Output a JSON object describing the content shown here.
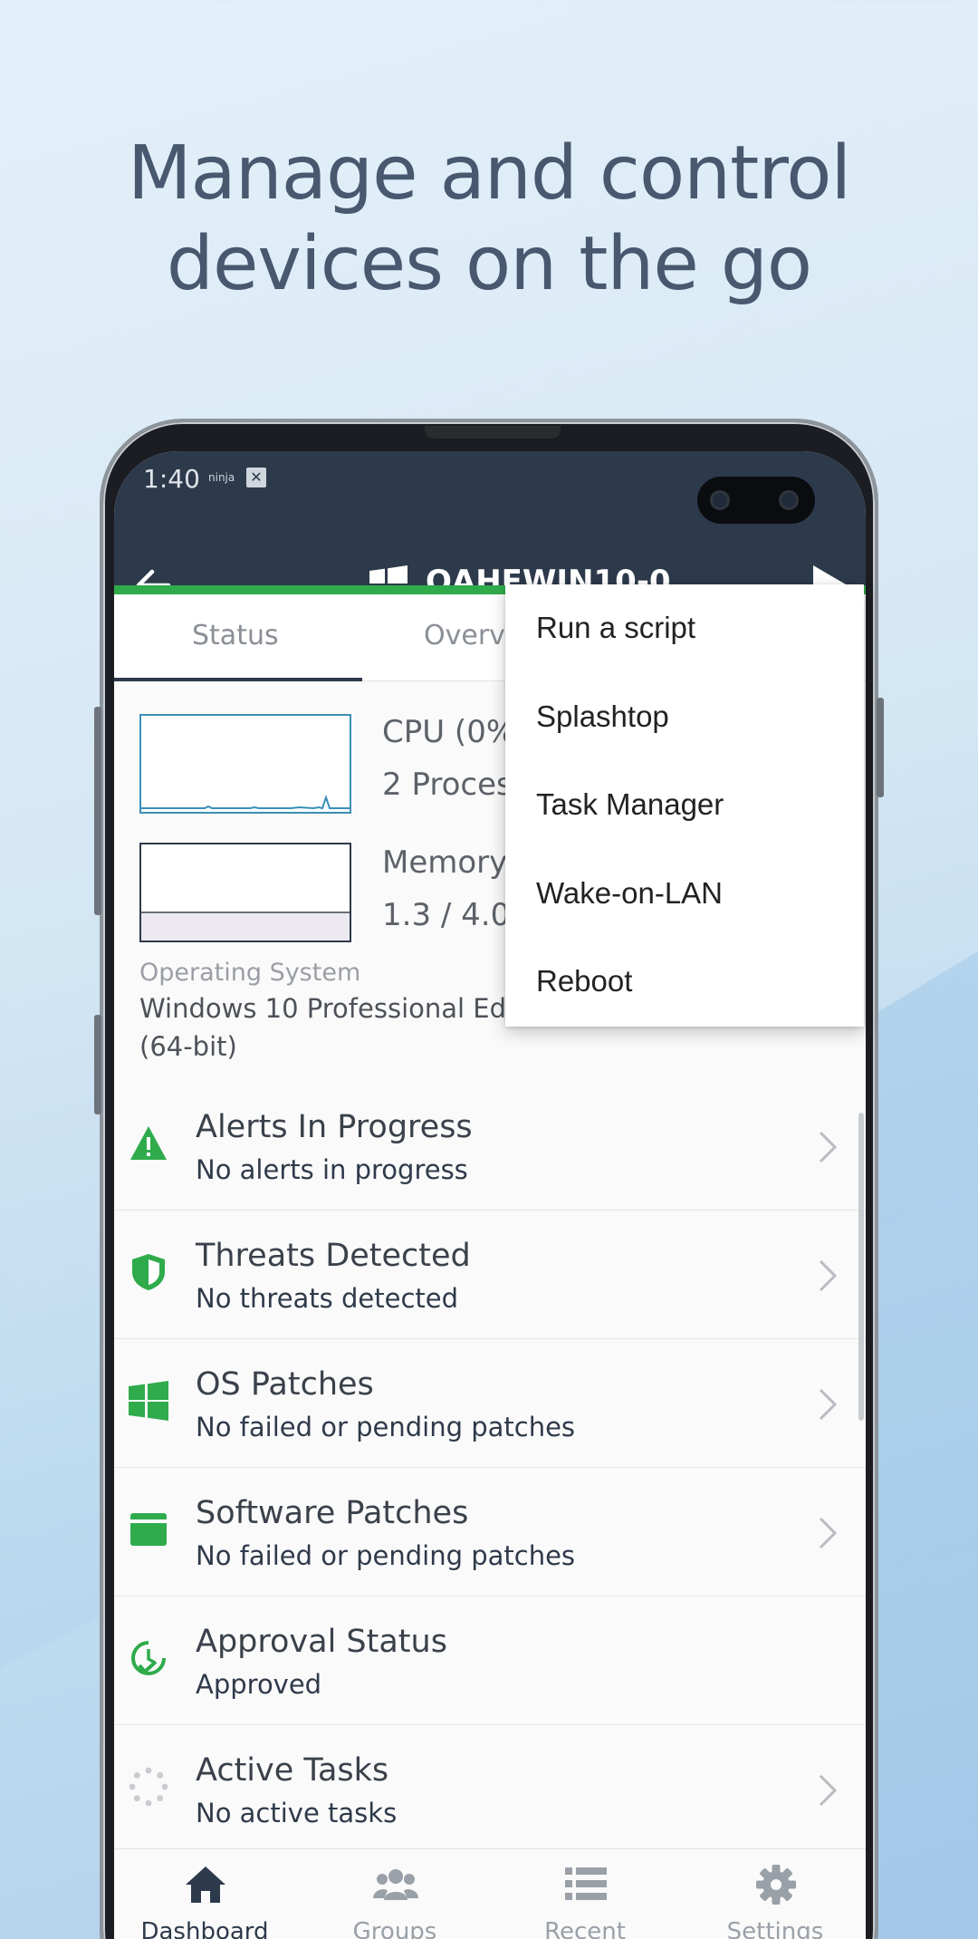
{
  "headline": {
    "line1": "Manage and control",
    "line2": "devices on the go"
  },
  "statusbar": {
    "time": "1:40",
    "app_tag": "ninja",
    "close_glyph": "✕"
  },
  "appbar": {
    "title": "QAHFWIN10-0",
    "back_icon": "arrow-left-icon",
    "os_icon": "windows-icon",
    "action_icon": "play-icon"
  },
  "tabs": [
    {
      "label": "Status",
      "active": true
    },
    {
      "label": "Overv"
    }
  ],
  "metrics": {
    "cpu_title": "CPU (0%",
    "cpu_sub": "2 Proces",
    "memory_title": "Memory",
    "memory_sub": "1.3 / 4.0"
  },
  "os": {
    "label": "Operating System",
    "value_line1": "Windows 10 Professional Ed",
    "value_line2": "(64-bit)"
  },
  "list": [
    {
      "title": "Alerts In Progress",
      "subtitle": "No alerts in progress",
      "icon": "warning-icon",
      "color": "#2fab4c",
      "chevron": true
    },
    {
      "title": "Threats Detected",
      "subtitle": "No threats detected",
      "icon": "shield-icon",
      "color": "#2fab4c",
      "chevron": true
    },
    {
      "title": "OS Patches",
      "subtitle": "No failed or pending patches",
      "icon": "windows-icon",
      "color": "#2fab4c",
      "chevron": true
    },
    {
      "title": "Software Patches",
      "subtitle": "No failed or pending patches",
      "icon": "software-icon",
      "color": "#2fab4c",
      "chevron": true
    },
    {
      "title": "Approval Status",
      "subtitle": "Approved",
      "icon": "clock-check-icon",
      "color": "#2fab4c",
      "chevron": false
    },
    {
      "title": "Active Tasks",
      "subtitle": "No active tasks",
      "icon": "spinner-icon",
      "color": "#c8cbd0",
      "chevron": true
    }
  ],
  "menu": [
    {
      "label": "Run a script"
    },
    {
      "label": "Splashtop"
    },
    {
      "label": "Task Manager"
    },
    {
      "label": "Wake-on-LAN"
    },
    {
      "label": "Reboot"
    }
  ],
  "bottom_nav": [
    {
      "label": "Dashboard",
      "icon": "home-icon",
      "active": true
    },
    {
      "label": "Groups",
      "icon": "users-icon",
      "active": false
    },
    {
      "label": "Recent",
      "icon": "list-icon",
      "active": false
    },
    {
      "label": "Settings",
      "icon": "gear-icon",
      "active": false
    }
  ],
  "colors": {
    "header": "#2d3a4b",
    "accent_green": "#2fab4c",
    "headline_text": "#47586f"
  }
}
